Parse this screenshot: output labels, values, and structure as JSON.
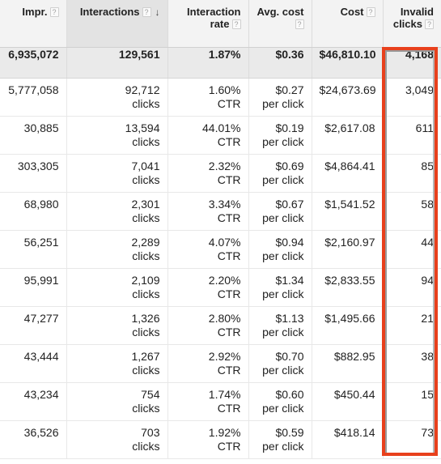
{
  "table": {
    "columns": [
      {
        "key": "impr",
        "label": "Impr.",
        "help": "?",
        "has_help": true,
        "sorted": false,
        "sort_arrow": ""
      },
      {
        "key": "interactions",
        "label": "Interactions",
        "help": "?",
        "has_help": true,
        "sorted": true,
        "sort_arrow": "↓"
      },
      {
        "key": "rate",
        "label": "Interaction rate",
        "help": "?",
        "has_help": true,
        "sorted": false,
        "sort_arrow": ""
      },
      {
        "key": "avg_cost",
        "label": "Avg. cost",
        "help": "?",
        "has_help": true,
        "sorted": false,
        "sort_arrow": ""
      },
      {
        "key": "cost",
        "label": "Cost",
        "help": "?",
        "has_help": true,
        "sorted": false,
        "sort_arrow": ""
      },
      {
        "key": "invalid",
        "label": "Invalid clicks",
        "help": "?",
        "has_help": true,
        "sorted": false,
        "sort_arrow": ""
      }
    ],
    "totals": {
      "impr": "6,935,072",
      "interactions": "129,561",
      "rate": "1.87%",
      "avg_cost": "$0.36",
      "cost": "$46,810.10",
      "invalid": "4,168"
    },
    "units": {
      "interactions": "clicks",
      "rate": "CTR",
      "avg_cost": "per click"
    },
    "rows": [
      {
        "impr": "5,777,058",
        "interactions": "92,712",
        "interactions_unit": "clicks",
        "rate": "1.60%",
        "rate_unit": "CTR",
        "avg_cost": "$0.27",
        "avg_cost_unit": "per click",
        "cost": "$24,673.69",
        "invalid": "3,049"
      },
      {
        "impr": "30,885",
        "interactions": "13,594",
        "interactions_unit": "clicks",
        "rate": "44.01%",
        "rate_unit": "CTR",
        "avg_cost": "$0.19",
        "avg_cost_unit": "per click",
        "cost": "$2,617.08",
        "invalid": "611"
      },
      {
        "impr": "303,305",
        "interactions": "7,041",
        "interactions_unit": "clicks",
        "rate": "2.32%",
        "rate_unit": "CTR",
        "avg_cost": "$0.69",
        "avg_cost_unit": "per click",
        "cost": "$4,864.41",
        "invalid": "85"
      },
      {
        "impr": "68,980",
        "interactions": "2,301",
        "interactions_unit": "clicks",
        "rate": "3.34%",
        "rate_unit": "CTR",
        "avg_cost": "$0.67",
        "avg_cost_unit": "per click",
        "cost": "$1,541.52",
        "invalid": "58"
      },
      {
        "impr": "56,251",
        "interactions": "2,289",
        "interactions_unit": "clicks",
        "rate": "4.07%",
        "rate_unit": "CTR",
        "avg_cost": "$0.94",
        "avg_cost_unit": "per click",
        "cost": "$2,160.97",
        "invalid": "44"
      },
      {
        "impr": "95,991",
        "interactions": "2,109",
        "interactions_unit": "clicks",
        "rate": "2.20%",
        "rate_unit": "CTR",
        "avg_cost": "$1.34",
        "avg_cost_unit": "per click",
        "cost": "$2,833.55",
        "invalid": "94"
      },
      {
        "impr": "47,277",
        "interactions": "1,326",
        "interactions_unit": "clicks",
        "rate": "2.80%",
        "rate_unit": "CTR",
        "avg_cost": "$1.13",
        "avg_cost_unit": "per click",
        "cost": "$1,495.66",
        "invalid": "21"
      },
      {
        "impr": "43,444",
        "interactions": "1,267",
        "interactions_unit": "clicks",
        "rate": "2.92%",
        "rate_unit": "CTR",
        "avg_cost": "$0.70",
        "avg_cost_unit": "per click",
        "cost": "$882.95",
        "invalid": "38"
      },
      {
        "impr": "43,234",
        "interactions": "754",
        "interactions_unit": "clicks",
        "rate": "1.74%",
        "rate_unit": "CTR",
        "avg_cost": "$0.60",
        "avg_cost_unit": "per click",
        "cost": "$450.44",
        "invalid": "15"
      },
      {
        "impr": "36,526",
        "interactions": "703",
        "interactions_unit": "clicks",
        "rate": "1.92%",
        "rate_unit": "CTR",
        "avg_cost": "$0.59",
        "avg_cost_unit": "per click",
        "cost": "$418.14",
        "invalid": "73"
      }
    ]
  },
  "annotation": {
    "highlight_column": "Invalid clicks",
    "highlight_color": "#e8401c"
  }
}
